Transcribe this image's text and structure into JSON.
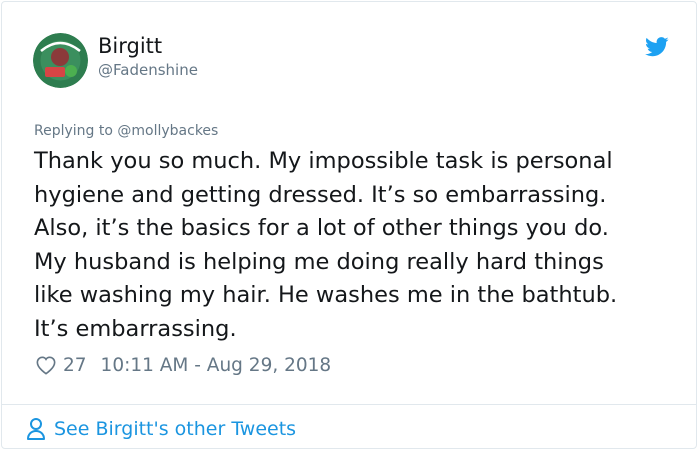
{
  "author": {
    "display_name": "Birgitt",
    "handle": "@Fadenshine",
    "avatar_icon": "profile-photo-avatar"
  },
  "reply": {
    "prefix": "Replying to ",
    "mention": "@mollybackes"
  },
  "tweet": {
    "text": "Thank you so much. My impossible task is personal\nhygiene and getting dressed. It’s so embarrassing.\nAlso, it’s the basics for a lot of other things you do.\nMy husband is helping me doing really hard things\nlike washing my hair. He washes me in the bathtub.\nIt’s embarrassing."
  },
  "meta": {
    "likes": "27",
    "timestamp": "10:11 AM - Aug 29, 2018"
  },
  "footer": {
    "link_label": "See Birgitt's other Tweets"
  },
  "colors": {
    "text": "#14171a",
    "muted": "#657786",
    "link": "#1b95e0",
    "twitter_blue": "#1da1f2",
    "border": "#e1e8ed"
  }
}
